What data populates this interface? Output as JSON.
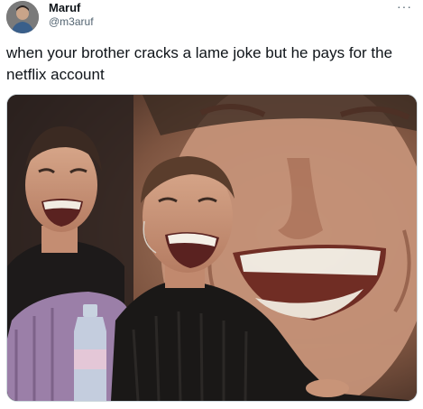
{
  "tweet": {
    "author_name": "Maruf",
    "author_handle": "@m3aruf",
    "text": "when your brother cracks a lame joke but he pays for the netflix account",
    "more_icon": "more-horizontal-icon"
  },
  "colors": {
    "text_primary": "#0f1419",
    "text_secondary": "#536471",
    "media_border": "#cfd9de"
  }
}
